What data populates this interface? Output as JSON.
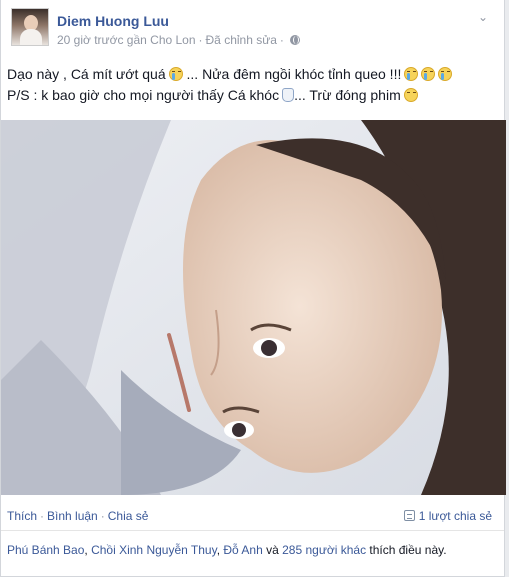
{
  "post": {
    "author": "Diem Huong Luu",
    "time": "20 giờ trước gần Cho Lon",
    "edited": "Đã chỉnh sửa",
    "privacy_icon": "globe-icon",
    "menu_icon": "chevron-down-icon",
    "text_line1_a": "Dạo này , Cá mít ướt quá",
    "text_line1_b": "... Nửa đêm ngồi khóc tỉnh queo !!!",
    "text_line2_a": "P/S : k bao giờ cho mọi người thấy Cá khóc",
    "text_line2_b": "... Trừ đóng phim"
  },
  "actions": {
    "like": "Thích",
    "comment": "Bình luận",
    "share": "Chia sẻ",
    "share_count": "1 lượt chia sẻ"
  },
  "likes": {
    "name1": "Phú Bánh Bao",
    "sep1": ", ",
    "name2": "Chồi Xinh Nguyễn Thuy",
    "sep2": ", ",
    "name3": "Đỗ Anh",
    "and": " và ",
    "others": "285 người khác",
    "suffix": " thích điều này."
  },
  "colors": {
    "link": "#3b5998",
    "meta": "#9197a3",
    "text": "#141823"
  }
}
